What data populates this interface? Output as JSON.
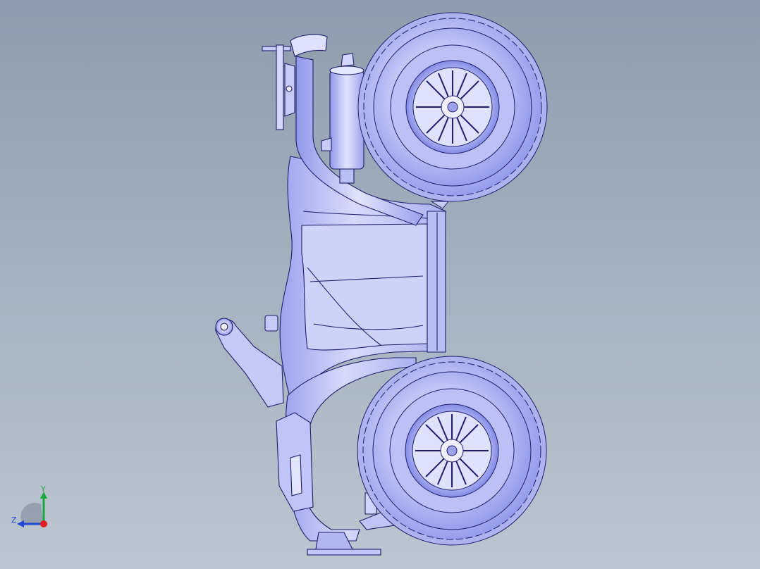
{
  "viewport": {
    "colors": {
      "background_top": "#8f9cad",
      "background_bottom": "#bcc6d1",
      "part_fill": "#c9ccf6",
      "part_shade": "#9aa0ec",
      "edge": "#1e1f6e"
    }
  },
  "model": {
    "parts": [
      "front-wheel",
      "rear-wheel",
      "body-fender",
      "handlebar",
      "exhaust-muffler",
      "seat-rack",
      "footrest"
    ]
  },
  "triad": {
    "y_label": "Y",
    "z_label": "Z",
    "colors": {
      "y": "#1aa83a",
      "z": "#2646d6",
      "x": "#e02020"
    }
  }
}
